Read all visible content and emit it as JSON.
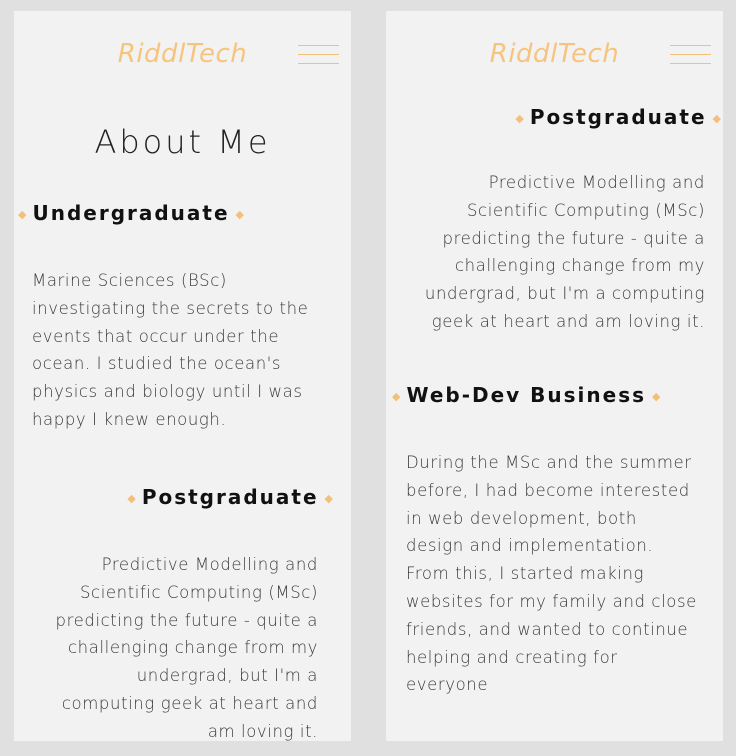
{
  "left": {
    "brand": "RiddlTech",
    "title": "About Me",
    "undergrad_heading": "Undergraduate",
    "undergrad_text": "Marine Sciences (BSc) investigating the secrets to the events that occur under the ocean. I studied the ocean's physics and biology until I was happy I knew enough.",
    "postgrad_heading": "Postgraduate",
    "postgrad_text": "Predictive Modelling and Scientific Computing (MSc) predicting the future - quite a challenging change from my undergrad, but I'm a computing geek at heart and am loving it."
  },
  "right": {
    "brand": "RiddlTech",
    "postgrad_heading": "Postgraduate",
    "postgrad_text": "Predictive Modelling and Scientific Computing (MSc) predicting the future - quite a challenging change from my undergrad, but I'm a computing geek at heart and am loving it.",
    "webdev_heading": "Web-Dev Business",
    "webdev_text": "During the MSc and the summer before, I had become interested in web development, both design and implementation. From this, I started making websites for my family and close friends, and wanted to continue helping and creating for everyone"
  },
  "icons": {
    "menu": "hamburger-menu-icon",
    "bullet": "diamond-bullet-icon"
  },
  "colors": {
    "brand": "#f7c47e",
    "accent": "#f3c07c",
    "panel": "#f2f2f2",
    "background": "#e0e0e0"
  }
}
